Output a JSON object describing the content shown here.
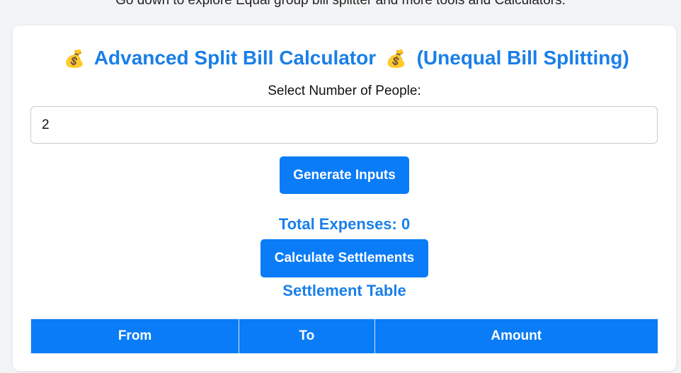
{
  "top_note": "Go down to explore Equal group bill splitter and more tools and Calculators.",
  "calculator": {
    "title_icon": "money-bag-icon",
    "title_emoji": "💰",
    "title_main": "Advanced Split Bill Calculator",
    "title_sub": "(Unequal Bill Splitting)",
    "people_label": "Select Number of People:",
    "people_value": "2",
    "generate_label": "Generate Inputs",
    "total_label": "Total Expenses: 0",
    "calculate_label": "Calculate Settlements",
    "settlement_title": "Settlement Table",
    "table_headers": [
      "From",
      "To",
      "Amount"
    ]
  },
  "colors": {
    "accent": "#1a7fe8",
    "button": "#0a7cf7"
  }
}
